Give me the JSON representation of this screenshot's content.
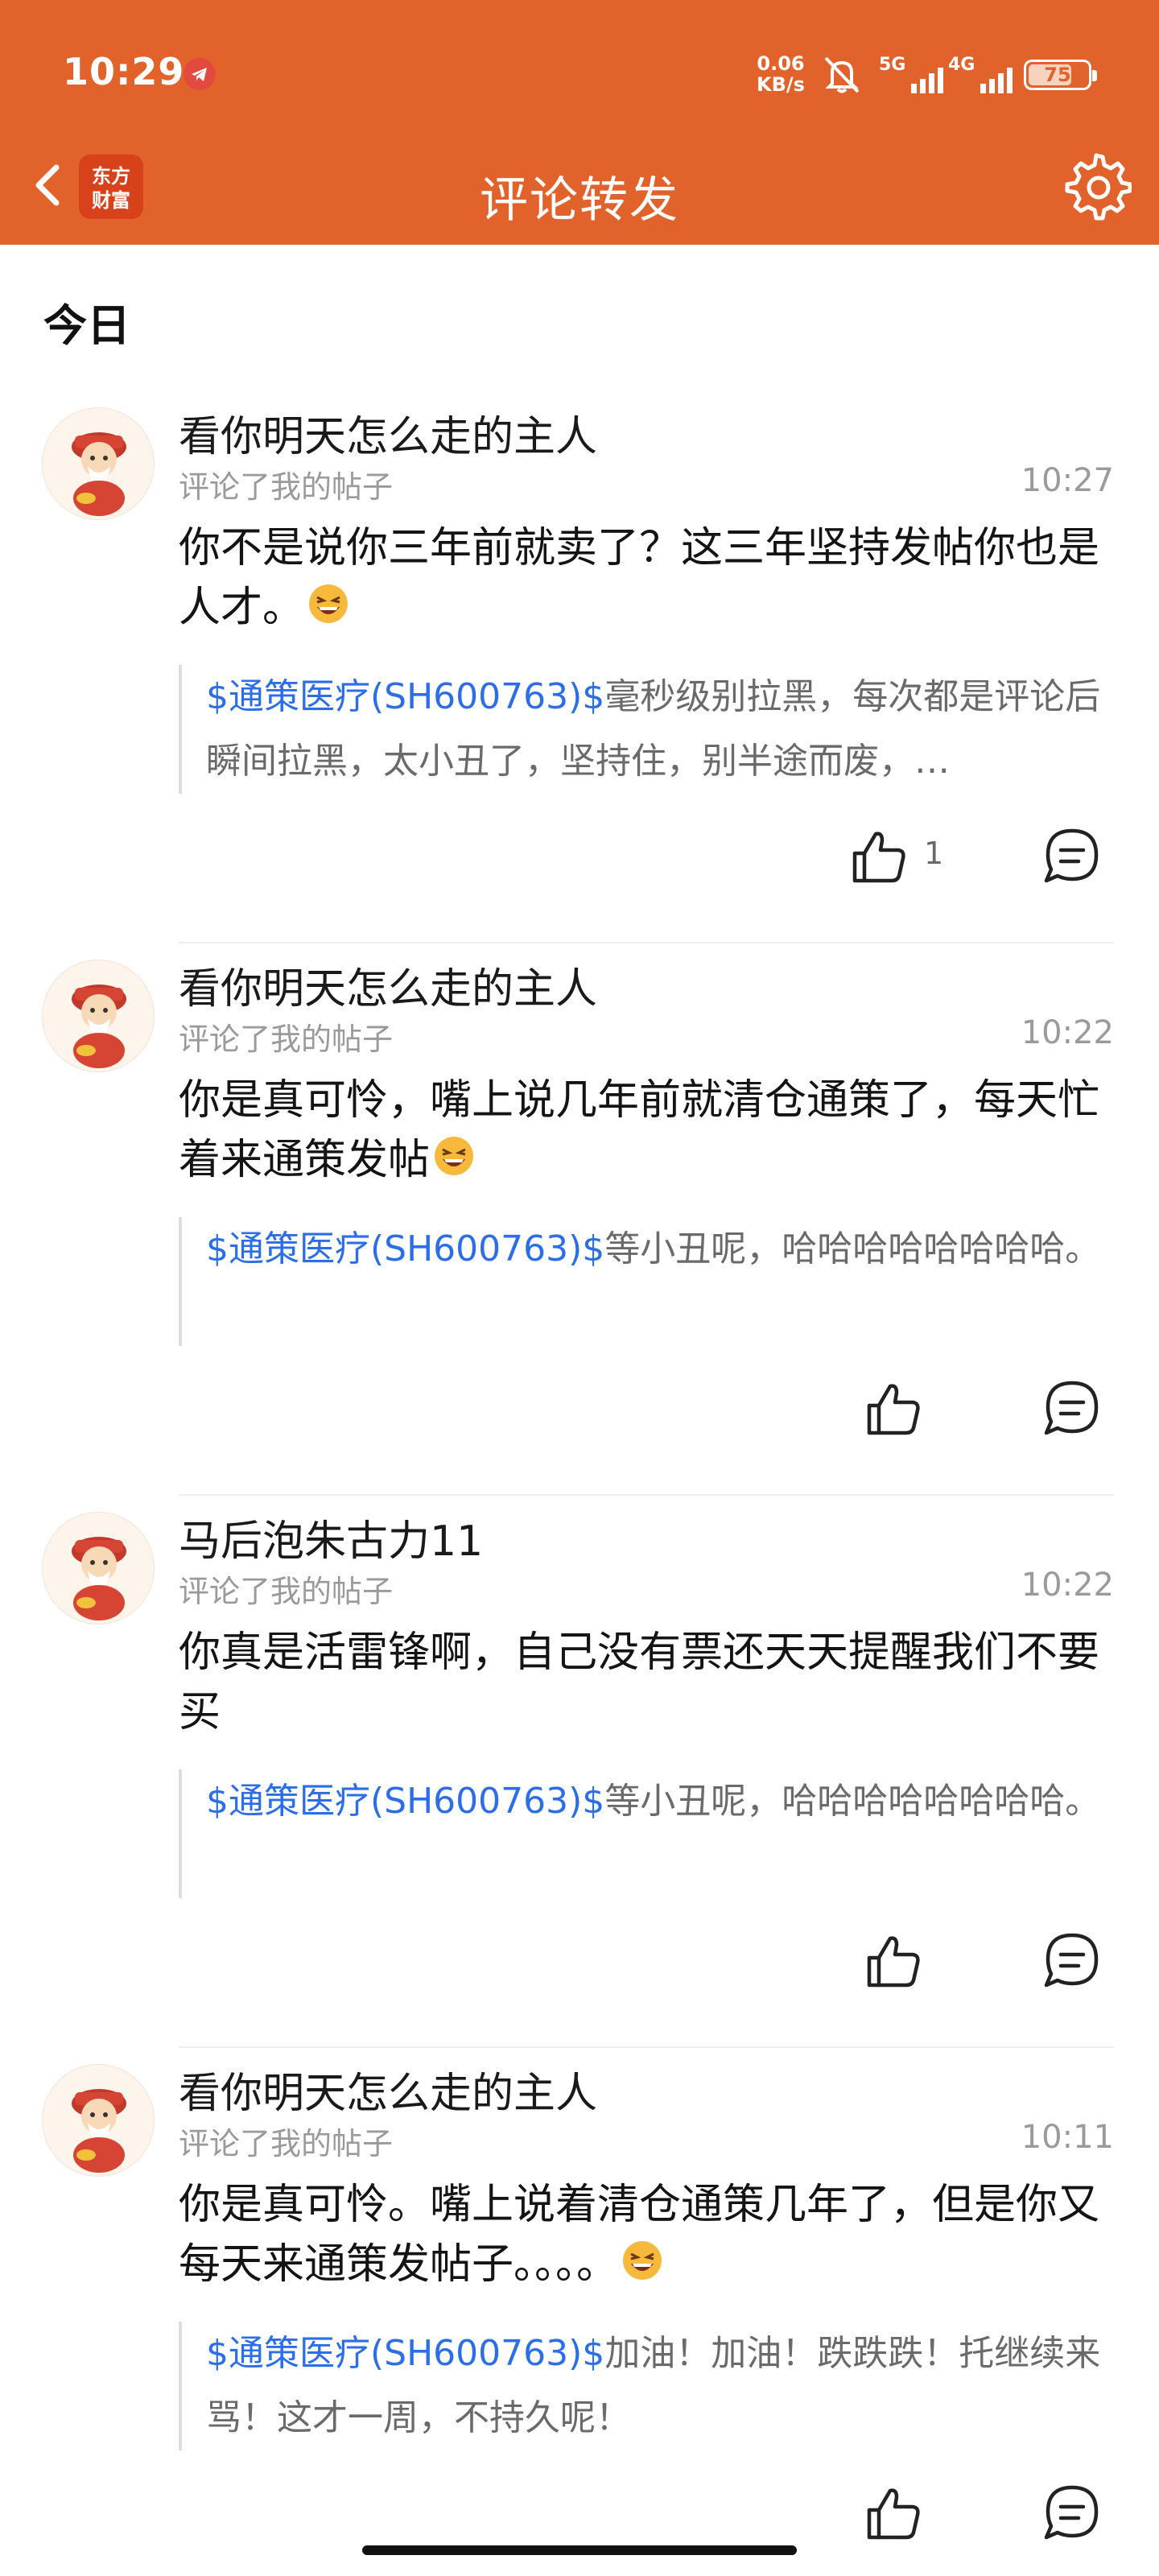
{
  "status_bar": {
    "time": "10:29",
    "net_speed_value": "0.06",
    "net_speed_unit": "KB/s",
    "signal1_label": "5G",
    "signal2_label": "4G",
    "battery_level": "75",
    "battery_fraction": 0.75
  },
  "nav": {
    "logo_line1": "东方",
    "logo_line2": "财富",
    "title": "评论转发"
  },
  "section_title": "今日",
  "colors": {
    "header_bg": "#e2622c",
    "link_blue": "#2b6ee8",
    "secondary_text": "#9a9a9a"
  },
  "comments": [
    {
      "user": "看你明天怎么走的主人",
      "action": "评论了我的帖子",
      "time": "10:27",
      "text": "你不是说你三年前就卖了？这三年坚持发帖你也是人才。",
      "quote_link": "$通策医疗(SH600763)$",
      "quote_text": "毫秒级别拉黑，每次都是评论后瞬间拉黑，太小丑了，坚持住，别半途而废，…",
      "likes": "1"
    },
    {
      "user": "看你明天怎么走的主人",
      "action": "评论了我的帖子",
      "time": "10:22",
      "text": "你是真可怜，嘴上说几年前就清仓通策了，每天忙着来通策发帖",
      "quote_link": "$通策医疗(SH600763)$",
      "quote_text": "等小丑呢，哈哈哈哈哈哈哈哈。",
      "likes": ""
    },
    {
      "user": "马后泡朱古力11",
      "action": "评论了我的帖子",
      "time": "10:22",
      "text": "你真是活雷锋啊，自己没有票还天天提醒我们不要买",
      "quote_link": "$通策医疗(SH600763)$",
      "quote_text": "等小丑呢，哈哈哈哈哈哈哈哈。",
      "likes": ""
    },
    {
      "user": "看你明天怎么走的主人",
      "action": "评论了我的帖子",
      "time": "10:11",
      "text": "你是真可怜。嘴上说着清仓通策几年了，但是你又每天来通策发帖子。。。。",
      "quote_link": "$通策医疗(SH600763)$",
      "quote_text": "加油！加油！跌跌跌！托继续来骂！这才一周，不持久呢！",
      "likes": ""
    }
  ]
}
